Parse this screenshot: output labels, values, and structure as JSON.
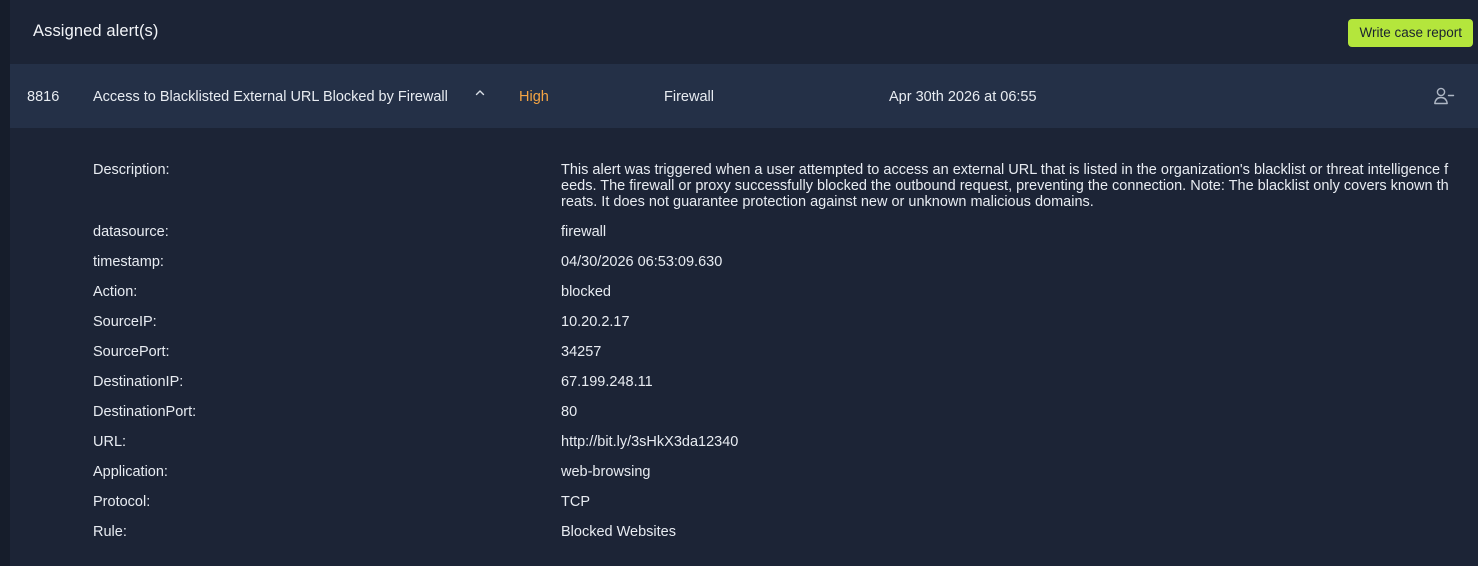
{
  "header": {
    "title": "Assigned alert(s)",
    "report_button_label": "Write case report"
  },
  "alert": {
    "id": "8816",
    "title": "Access to Blacklisted External URL Blocked by Firewall",
    "severity": "High",
    "source": "Firewall",
    "date": "Apr 30th 2026 at 06:55",
    "expand_icon": "chevron-up-icon",
    "assign_icon": "user-minus-icon"
  },
  "colors": {
    "severity_high": "#f5a443",
    "report_button": "#b4e63c",
    "row_background": "#243047",
    "panel_background": "#1c2436"
  },
  "details": [
    {
      "key": "Description:",
      "value": "This alert was triggered when a user attempted to access an external URL that is listed in the organization's blacklist or threat intelligence feeds. The firewall or proxy successfully blocked the outbound request, preventing the connection. Note: The blacklist only covers known threats. It does not guarantee protection against new or unknown malicious domains."
    },
    {
      "key": "datasource:",
      "value": "firewall"
    },
    {
      "key": "timestamp:",
      "value": "04/30/2026 06:53:09.630"
    },
    {
      "key": "Action:",
      "value": "blocked"
    },
    {
      "key": "SourceIP:",
      "value": "10.20.2.17"
    },
    {
      "key": "SourcePort:",
      "value": "34257"
    },
    {
      "key": "DestinationIP:",
      "value": "67.199.248.11"
    },
    {
      "key": "DestinationPort:",
      "value": "80"
    },
    {
      "key": "URL:",
      "value": "http://bit.ly/3sHkX3da12340"
    },
    {
      "key": "Application:",
      "value": "web-browsing"
    },
    {
      "key": "Protocol:",
      "value": "TCP"
    },
    {
      "key": "Rule:",
      "value": "Blocked Websites"
    }
  ]
}
